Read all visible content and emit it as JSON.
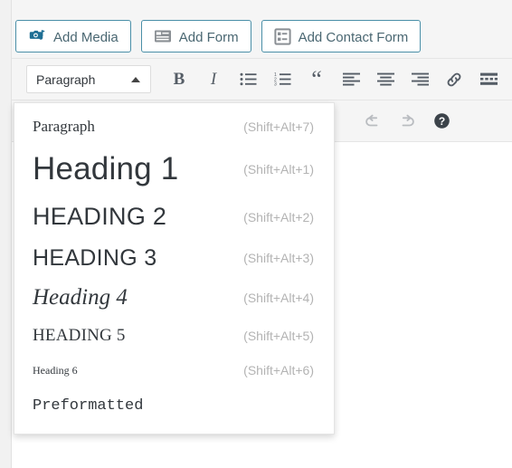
{
  "media_bar": {
    "buttons": [
      {
        "label": "Add Media",
        "icon": "media-camera-note-icon"
      },
      {
        "label": "Add Form",
        "icon": "form-list-icon"
      },
      {
        "label": "Add Contact Form",
        "icon": "contact-form-icon"
      }
    ]
  },
  "toolbar": {
    "format_select": {
      "value": "Paragraph",
      "caret": "caret-up-icon",
      "expanded": true
    },
    "row1": [
      {
        "name": "bold",
        "label": "B",
        "icon": "bold-icon"
      },
      {
        "name": "italic",
        "label": "I",
        "icon": "italic-icon"
      },
      {
        "name": "bulleted-list",
        "label": "",
        "icon": "bulleted-list-icon"
      },
      {
        "name": "numbered-list",
        "label": "",
        "icon": "numbered-list-icon"
      },
      {
        "name": "blockquote",
        "label": "“",
        "icon": "blockquote-icon"
      },
      {
        "name": "align-left",
        "label": "",
        "icon": "align-left-icon"
      },
      {
        "name": "align-center",
        "label": "",
        "icon": "align-center-icon"
      },
      {
        "name": "align-right",
        "label": "",
        "icon": "align-right-icon"
      },
      {
        "name": "insert-link",
        "label": "",
        "icon": "link-icon"
      },
      {
        "name": "insert-read-more",
        "label": "",
        "icon": "read-more-icon"
      }
    ],
    "row2": [
      {
        "name": "undo",
        "label": "",
        "icon": "undo-icon"
      },
      {
        "name": "redo",
        "label": "",
        "icon": "redo-icon"
      },
      {
        "name": "keyboard-shortcuts-help",
        "label": "?",
        "icon": "help-icon"
      }
    ]
  },
  "format_menu": {
    "items": [
      {
        "label": "Paragraph",
        "shortcut": "(Shift+Alt+7)",
        "style": "style-paragraph"
      },
      {
        "label": "Heading 1",
        "shortcut": "(Shift+Alt+1)",
        "style": "style-h1"
      },
      {
        "label": "Heading 2",
        "shortcut": "(Shift+Alt+2)",
        "style": "style-h2"
      },
      {
        "label": "Heading 3",
        "shortcut": "(Shift+Alt+3)",
        "style": "style-h3"
      },
      {
        "label": "Heading 4",
        "shortcut": "(Shift+Alt+4)",
        "style": "style-h4"
      },
      {
        "label": "Heading 5",
        "shortcut": "(Shift+Alt+5)",
        "style": "style-h5"
      },
      {
        "label": "Heading 6",
        "shortcut": "(Shift+Alt+6)",
        "style": "style-h6"
      },
      {
        "label": "Preformatted",
        "shortcut": "",
        "style": "style-pre"
      }
    ]
  },
  "colors": {
    "accent": "#4a8fa8",
    "media_icon_blue": "#1f6f94",
    "icon_gray": "#555d66",
    "shortcut_gray": "#b3b3b3",
    "toolbar_bg": "#f5f5f5",
    "page_bg": "#f1f1f1"
  }
}
